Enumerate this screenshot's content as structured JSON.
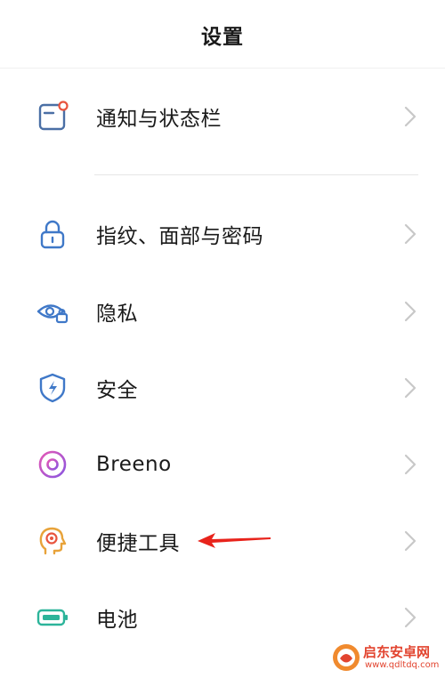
{
  "header": {
    "title": "设置"
  },
  "items": [
    {
      "label": "通知与状态栏",
      "icon": "notification-statusbar-icon",
      "color": "#4a6fa5"
    },
    {
      "label": "指纹、面部与密码",
      "icon": "lock-icon",
      "color": "#3f78c8"
    },
    {
      "label": "隐私",
      "icon": "eye-lock-icon",
      "color": "#3f78c8"
    },
    {
      "label": "安全",
      "icon": "shield-lightning-icon",
      "color": "#3f78c8"
    },
    {
      "label": "Breeno",
      "icon": "breeno-ring-icon",
      "color": "#c04dc8"
    },
    {
      "label": "便捷工具",
      "icon": "head-target-icon",
      "color": "#e8a33a"
    },
    {
      "label": "电池",
      "icon": "battery-icon",
      "color": "#2cb49a"
    }
  ],
  "annotation": {
    "arrow_color": "#e8231b"
  },
  "watermark": {
    "name": "启东安卓网",
    "url": "www.qdltdq.com",
    "color": "#e2442f"
  }
}
